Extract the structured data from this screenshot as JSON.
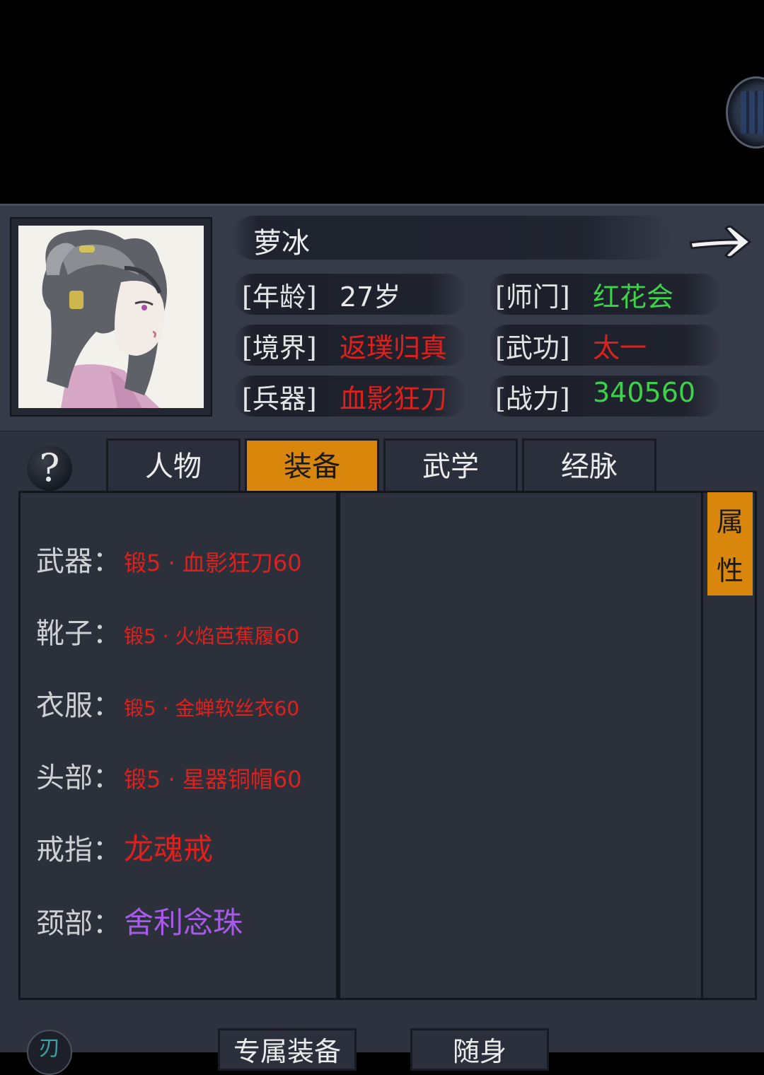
{
  "header": {
    "name": "萝冰",
    "age_label": "[年龄]",
    "age_value": "27岁",
    "sect_label": "[师门]",
    "sect_value": "红花会",
    "realm_label": "[境界]",
    "realm_value": "返璞归真",
    "martial_label": "[武功]",
    "martial_value": "太一",
    "weapon_label": "[兵器]",
    "weapon_value": "血影狂刀",
    "power_label": "[战力]",
    "power_value": "340560"
  },
  "help": {
    "symbol": "?"
  },
  "tabs": [
    {
      "label": "人物",
      "active": false
    },
    {
      "label": "装备",
      "active": true
    },
    {
      "label": "武学",
      "active": false
    },
    {
      "label": "经脉",
      "active": false
    }
  ],
  "equipment": [
    {
      "slot": "武器：",
      "item": "锻5 · 血影狂刀60",
      "color": "#e0201c"
    },
    {
      "slot": "靴子：",
      "item": "锻5 · 火焰芭蕉履60",
      "color": "#e0201c"
    },
    {
      "slot": "衣服：",
      "item": "锻5 · 金蝉软丝衣60",
      "color": "#e0201c"
    },
    {
      "slot": "头部：",
      "item": "锻5 · 星器铜帽60",
      "color": "#e0201c"
    },
    {
      "slot": "戒指：",
      "item": "龙魂戒",
      "color": "#e0201c"
    },
    {
      "slot": "颈部：",
      "item": "舍利念珠",
      "color": "#a85be8"
    }
  ],
  "side_tab": {
    "line1": "属",
    "line2": "性"
  },
  "bottom": {
    "logo_glyph": "刃",
    "btn1": "专属装备",
    "btn2": "随身"
  },
  "colors": {
    "accent": "#d8870c",
    "red": "#e0201c",
    "green": "#3ed24a",
    "purple": "#a85be8"
  }
}
